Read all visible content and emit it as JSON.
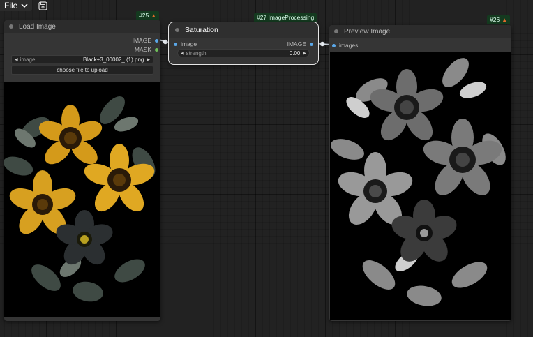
{
  "menu": {
    "file_label": "File"
  },
  "icons": {
    "file_menu": "chevron-down-icon",
    "save": "save-icon",
    "badge": "fox-icon"
  },
  "colors": {
    "image_port": "#5aa7e8",
    "mask_port": "#6fbf5a",
    "badge_bg": "#143a1f",
    "fox": "#e06a2c"
  },
  "load_node": {
    "badge": "#25",
    "title": "Load Image",
    "outputs": [
      "IMAGE",
      "MASK"
    ],
    "image_widget": {
      "label": "image",
      "value": "Black+3_00002_ (1).png"
    },
    "upload_label": "choose file to upload",
    "image_desc": "color flowers"
  },
  "saturation_node": {
    "badge": "#27 ImageProcessing",
    "title": "Saturation",
    "input": "image",
    "output": "IMAGE",
    "strength_widget": {
      "label": "strength",
      "value": "0.00"
    }
  },
  "preview_node": {
    "badge": "#26",
    "title": "Preview Image",
    "input": "images"
  }
}
